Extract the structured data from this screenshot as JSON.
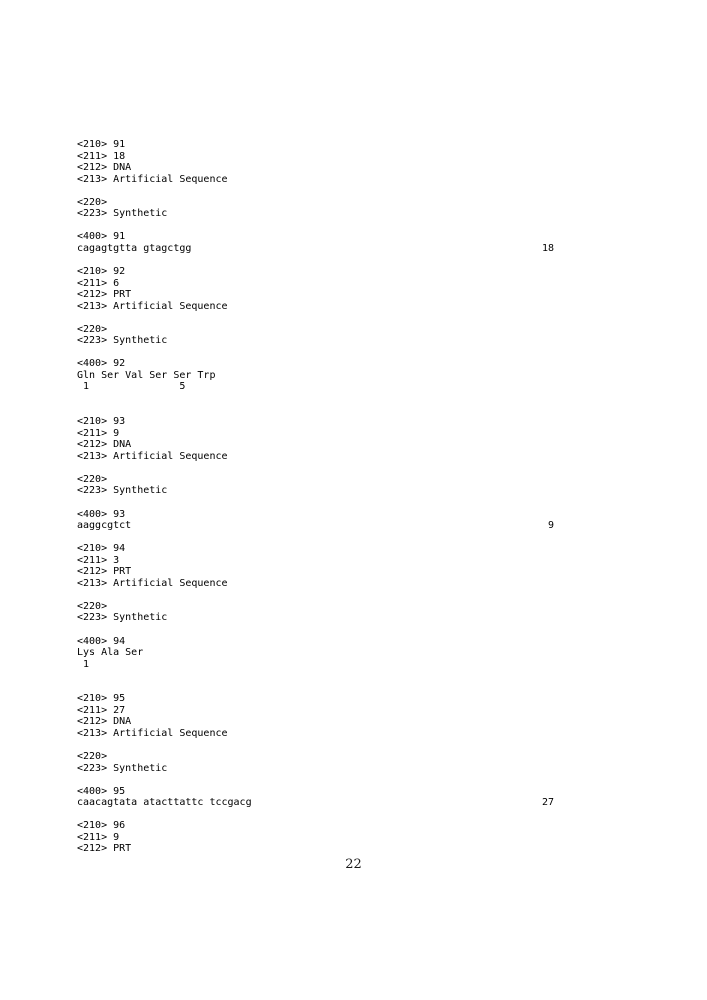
{
  "document": {
    "kind": "patent-sequence-listing",
    "page_number": "22",
    "count_column_label": "",
    "blocks": [
      {
        "id": "seq-91",
        "lines": [
          {
            "text": "<210> 91"
          },
          {
            "text": "<211> 18"
          },
          {
            "text": "<212> DNA"
          },
          {
            "text": "<213> Artificial Sequence"
          },
          {
            "text": ""
          },
          {
            "text": "<220>"
          },
          {
            "text": "<223> Synthetic"
          },
          {
            "text": ""
          },
          {
            "text": "<400> 91"
          },
          {
            "text": "cagagtgtta gtagctgg",
            "count": "18"
          }
        ]
      },
      {
        "id": "seq-92",
        "lines": [
          {
            "text": ""
          },
          {
            "text": "<210> 92"
          },
          {
            "text": "<211> 6"
          },
          {
            "text": "<212> PRT"
          },
          {
            "text": "<213> Artificial Sequence"
          },
          {
            "text": ""
          },
          {
            "text": "<220>"
          },
          {
            "text": "<223> Synthetic"
          },
          {
            "text": ""
          },
          {
            "text": "<400> 92"
          },
          {
            "text": "Gln Ser Val Ser Ser Trp"
          },
          {
            "text": " 1               5"
          }
        ]
      },
      {
        "id": "seq-93",
        "lines": [
          {
            "text": ""
          },
          {
            "text": ""
          },
          {
            "text": "<210> 93"
          },
          {
            "text": "<211> 9"
          },
          {
            "text": "<212> DNA"
          },
          {
            "text": "<213> Artificial Sequence"
          },
          {
            "text": ""
          },
          {
            "text": "<220>"
          },
          {
            "text": "<223> Synthetic"
          },
          {
            "text": ""
          },
          {
            "text": "<400> 93"
          },
          {
            "text": "aaggcgtct",
            "count": "9"
          }
        ]
      },
      {
        "id": "seq-94",
        "lines": [
          {
            "text": ""
          },
          {
            "text": "<210> 94"
          },
          {
            "text": "<211> 3"
          },
          {
            "text": "<212> PRT"
          },
          {
            "text": "<213> Artificial Sequence"
          },
          {
            "text": ""
          },
          {
            "text": "<220>"
          },
          {
            "text": "<223> Synthetic"
          },
          {
            "text": ""
          },
          {
            "text": "<400> 94"
          },
          {
            "text": "Lys Ala Ser"
          },
          {
            "text": " 1"
          }
        ]
      },
      {
        "id": "seq-95",
        "lines": [
          {
            "text": ""
          },
          {
            "text": ""
          },
          {
            "text": "<210> 95"
          },
          {
            "text": "<211> 27"
          },
          {
            "text": "<212> DNA"
          },
          {
            "text": "<213> Artificial Sequence"
          },
          {
            "text": ""
          },
          {
            "text": "<220>"
          },
          {
            "text": "<223> Synthetic"
          },
          {
            "text": ""
          },
          {
            "text": "<400> 95"
          },
          {
            "text": "caacagtata atacttattc tccgacg",
            "count": "27"
          }
        ]
      },
      {
        "id": "seq-96",
        "lines": [
          {
            "text": ""
          },
          {
            "text": "<210> 96"
          },
          {
            "text": "<211> 9"
          },
          {
            "text": "<212> PRT"
          }
        ]
      }
    ]
  }
}
